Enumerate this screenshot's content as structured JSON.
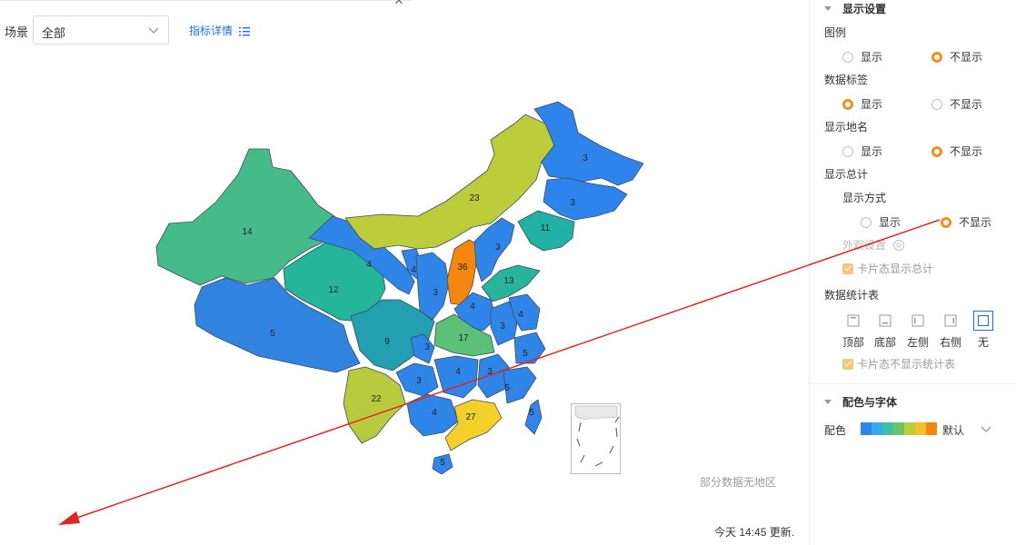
{
  "toolbar": {
    "scene_label": "场景",
    "scene_value": "全部",
    "detail_link": "指标详情"
  },
  "map": {
    "regions": [
      {
        "name": "xinjiang",
        "value": "14",
        "color": "#46bb8a"
      },
      {
        "name": "tibet",
        "value": "5",
        "color": "#3183e0"
      },
      {
        "name": "qinghai",
        "value": "12",
        "color": "#24b59b"
      },
      {
        "name": "gansu",
        "value": "4",
        "color": "#2f86e8"
      },
      {
        "name": "inner-mongolia",
        "value": "23",
        "color": "#bccd3c"
      },
      {
        "name": "heilongjiang",
        "value": "3",
        "color": "#2e84ea"
      },
      {
        "name": "jilin",
        "value": "3",
        "color": "#2e84ea"
      },
      {
        "name": "liaoning",
        "value": "11",
        "color": "#21b2a5"
      },
      {
        "name": "ningxia",
        "value": "4",
        "color": "#2f86e8"
      },
      {
        "name": "shaanxi",
        "value": "3",
        "color": "#2f86e8"
      },
      {
        "name": "shanxi",
        "value": "36",
        "color": "#f5860f"
      },
      {
        "name": "hebei",
        "value": "3",
        "color": "#2f86e8"
      },
      {
        "name": "shandong",
        "value": "13",
        "color": "#26b59a"
      },
      {
        "name": "henan",
        "value": "4",
        "color": "#2f86e8"
      },
      {
        "name": "sichuan",
        "value": "9",
        "color": "#229fb1"
      },
      {
        "name": "hubei",
        "value": "17",
        "color": "#5dc07a"
      },
      {
        "name": "anhui",
        "value": "3",
        "color": "#2f86e8"
      },
      {
        "name": "jiangsu",
        "value": "4",
        "color": "#2f86e8"
      },
      {
        "name": "chongqing",
        "value": "3",
        "color": "#2f86e8"
      },
      {
        "name": "hunan",
        "value": "4",
        "color": "#2f86e8"
      },
      {
        "name": "jiangxi",
        "value": "3",
        "color": "#2f86e8"
      },
      {
        "name": "zhejiang",
        "value": "5",
        "color": "#2f86e8"
      },
      {
        "name": "fujian",
        "value": "5",
        "color": "#2f86e8"
      },
      {
        "name": "yunnan",
        "value": "22",
        "color": "#b8cb3e"
      },
      {
        "name": "guizhou",
        "value": "3",
        "color": "#2f86e8"
      },
      {
        "name": "guangxi",
        "value": "4",
        "color": "#2f86e8"
      },
      {
        "name": "guangdong",
        "value": "27",
        "color": "#f3d02a"
      },
      {
        "name": "taiwan",
        "value": "5",
        "color": "#2f86e8"
      },
      {
        "name": "hainan",
        "value": "5",
        "color": "#2f86e8"
      }
    ],
    "no_data_note": "部分数据无地区",
    "update_note": "今天 14:45 更新."
  },
  "panel": {
    "display_settings": {
      "title": "显示设置",
      "legend": {
        "label": "图例",
        "show": "显示",
        "hide": "不显示",
        "selected": "不显示"
      },
      "data_labels": {
        "label": "数据标签",
        "show": "显示",
        "hide": "不显示",
        "selected": "显示"
      },
      "place_names": {
        "label": "显示地名",
        "show": "显示",
        "hide": "不显示",
        "selected": "不显示"
      },
      "total": {
        "label": "显示总计",
        "mode_label": "显示方式",
        "show": "显示",
        "hide": "不显示",
        "selected": "不显示"
      },
      "appearance": "外观设置",
      "card_total": "卡片态显示总计",
      "stats_table": {
        "label": "数据统计表",
        "options": [
          "顶部",
          "底部",
          "左侧",
          "右侧",
          "无"
        ],
        "selected": "无"
      },
      "card_hide_table": "卡片态不显示统计表"
    },
    "color_font": {
      "title": "配色与字体",
      "color_label": "配色",
      "palette": [
        "#2f86e8",
        "#37a9f0",
        "#3fc1a8",
        "#6cc56a",
        "#b9cf3c",
        "#f6c127",
        "#f5860f"
      ],
      "palette_name": "默认"
    }
  }
}
